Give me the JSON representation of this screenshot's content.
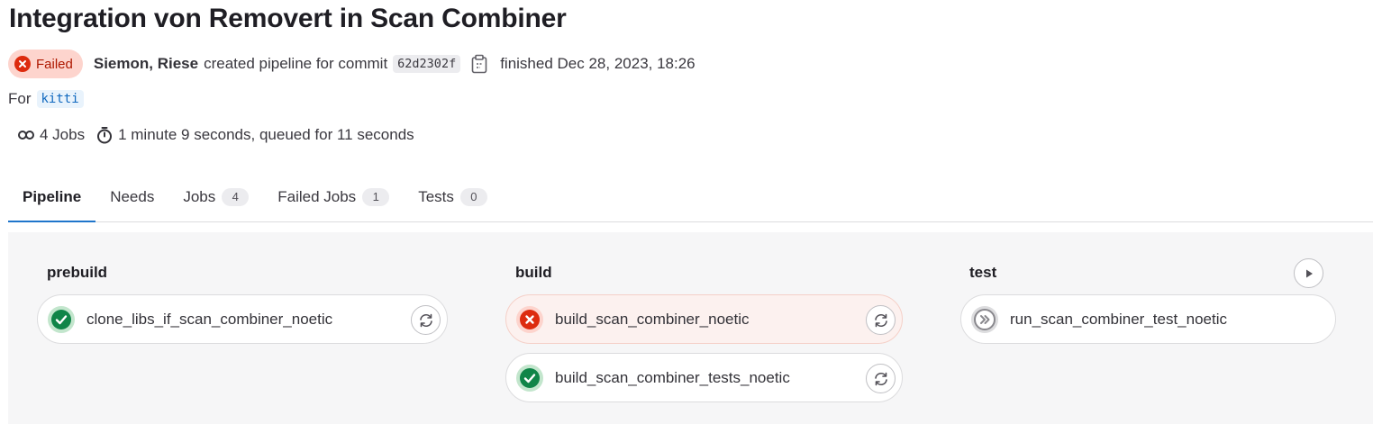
{
  "title": "Integration von Removert in Scan Combiner",
  "status_badge": {
    "label": "Failed",
    "icon": "failed-status-icon",
    "color": "#ae1800"
  },
  "meta": {
    "author": "Siemon, Riese",
    "action_text": "created pipeline for commit",
    "commit_sha": "62d2302f",
    "finished_text": "finished Dec 28, 2023, 18:26"
  },
  "ref": {
    "prefix": "For",
    "name": "kitti"
  },
  "stats": {
    "jobs": "4 Jobs",
    "duration": "1 minute 9 seconds, queued for 11 seconds"
  },
  "tabs": [
    {
      "label": "Pipeline",
      "count": null
    },
    {
      "label": "Needs",
      "count": null
    },
    {
      "label": "Jobs",
      "count": "4"
    },
    {
      "label": "Failed Jobs",
      "count": "1"
    },
    {
      "label": "Tests",
      "count": "0"
    }
  ],
  "stages": [
    {
      "name": "prebuild",
      "jobs": [
        {
          "name": "clone_libs_if_scan_combiner_noetic",
          "status": "success",
          "action": "retry"
        }
      ]
    },
    {
      "name": "build",
      "jobs": [
        {
          "name": "build_scan_combiner_noetic",
          "status": "failed",
          "action": "retry"
        },
        {
          "name": "build_scan_combiner_tests_noetic",
          "status": "success",
          "action": "retry"
        }
      ]
    },
    {
      "name": "test",
      "stage_action": "play",
      "jobs": [
        {
          "name": "run_scan_combiner_test_noetic",
          "status": "skipped",
          "action": null
        }
      ]
    }
  ],
  "colors": {
    "success": "#108548",
    "failed": "#dd2b0e",
    "skipped": "#89888d",
    "accent": "#1f75cb"
  }
}
